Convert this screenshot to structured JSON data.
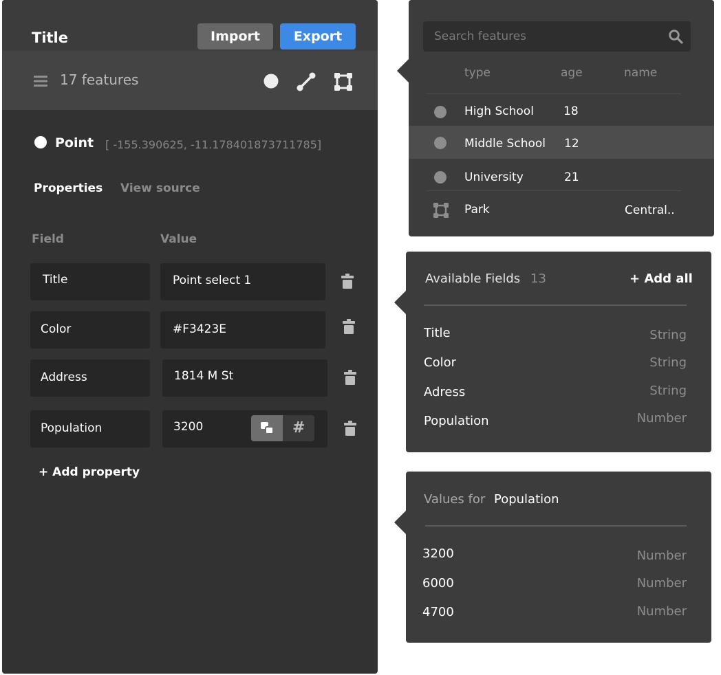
{
  "editor": {
    "title": "Title",
    "import_label": "Import",
    "export_label": "Export",
    "feature_count": "17 features",
    "feature": {
      "type": "Point",
      "coordinates": "[ -155.390625, -11.178401873711785]"
    },
    "tabs": {
      "active": "Properties",
      "inactive": "View source"
    },
    "columns": {
      "field": "Field",
      "value": "Value"
    },
    "properties": [
      {
        "field": "Title",
        "value": "Point select 1"
      },
      {
        "field": "Color",
        "value": "#F3423E"
      },
      {
        "field": "Address",
        "value": "1814 M St"
      },
      {
        "field": "Population",
        "value": "3200"
      }
    ],
    "add_property_label": "+ Add property",
    "type_toggle": {
      "selected": "text-type",
      "other": "#"
    }
  },
  "search_panel": {
    "placeholder": "Search features",
    "columns": [
      "type",
      "age",
      "name"
    ],
    "rows": [
      {
        "type": "High School",
        "age": "18",
        "name": "",
        "icon": "point"
      },
      {
        "type": "Middle School",
        "age": "12",
        "name": "",
        "icon": "point",
        "highlighted": true
      },
      {
        "type": "University",
        "age": "21",
        "name": "",
        "icon": "point"
      },
      {
        "type": "Park",
        "age": "",
        "name": "Central..",
        "icon": "polygon"
      }
    ]
  },
  "fields_panel": {
    "title": "Available Fields",
    "count": "13",
    "add_all_label": "+ Add all",
    "fields": [
      {
        "name": "Title",
        "type": "String"
      },
      {
        "name": "Color",
        "type": "String"
      },
      {
        "name": "Adress",
        "type": "String"
      },
      {
        "name": "Population",
        "type": "Number"
      }
    ]
  },
  "values_panel": {
    "label": "Values for",
    "field": "Population",
    "values": [
      {
        "value": "3200",
        "type": "Number"
      },
      {
        "value": "6000",
        "type": "Number"
      },
      {
        "value": "4700",
        "type": "Number"
      }
    ]
  },
  "colors": {
    "accent": "#3d8ae6",
    "panel": "#323232",
    "popover": "#3c3c3c"
  }
}
